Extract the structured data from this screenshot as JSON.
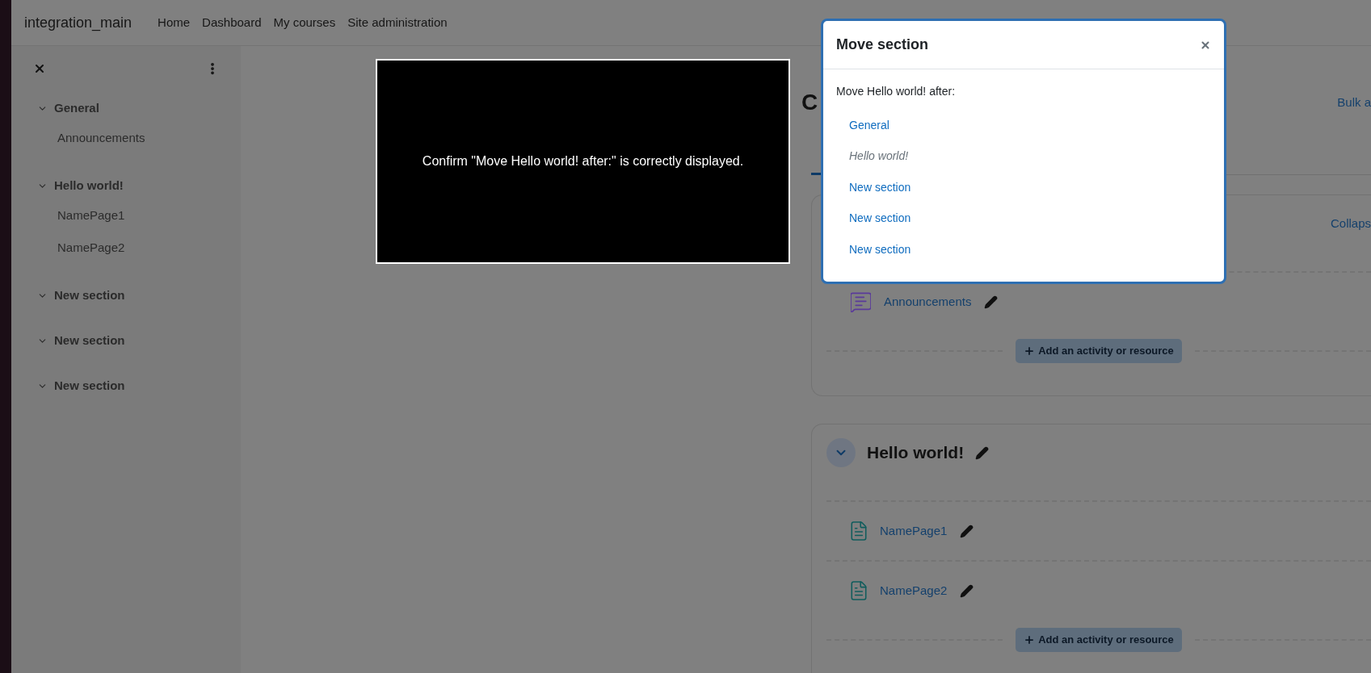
{
  "navbar": {
    "brand": "integration_main",
    "links": [
      "Home",
      "Dashboard",
      "My courses",
      "Site administration"
    ]
  },
  "sidebar": {
    "sections": [
      {
        "title": "General",
        "expanded": true,
        "children": [
          {
            "title": "Announcements"
          }
        ]
      },
      {
        "title": "Hello world!",
        "expanded": true,
        "children": [
          {
            "title": "NamePage1"
          },
          {
            "title": "NamePage2"
          }
        ]
      },
      {
        "title": "New section",
        "expanded": true
      },
      {
        "title": "New section",
        "expanded": true
      },
      {
        "title": "New section",
        "expanded": true
      }
    ]
  },
  "course": {
    "title": "C",
    "bulk_link": "Bulk a",
    "sections": [
      {
        "collapse_link": "Collaps",
        "activities": [
          {
            "kind": "forum",
            "name": "Announcements"
          }
        ],
        "add_button": "Add an activity or resource"
      },
      {
        "title": "Hello world!",
        "expanded": true,
        "activities": [
          {
            "kind": "page",
            "name": "NamePage1"
          },
          {
            "kind": "page",
            "name": "NamePage2"
          }
        ],
        "add_button": "Add an activity or resource"
      }
    ]
  },
  "note": {
    "text": "Confirm \"Move Hello world! after:\" is correctly displayed."
  },
  "modal": {
    "title": "Move section",
    "prompt": "Move Hello world! after:",
    "options": [
      {
        "label": "General",
        "disabled": false
      },
      {
        "label": "Hello world!",
        "disabled": true
      },
      {
        "label": "New section",
        "disabled": false
      },
      {
        "label": "New section",
        "disabled": false
      },
      {
        "label": "New section",
        "disabled": false
      }
    ]
  }
}
